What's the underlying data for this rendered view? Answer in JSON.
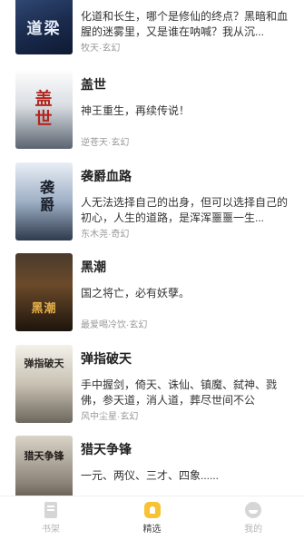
{
  "books": [
    {
      "cover_text": "道梁",
      "title": "",
      "desc": "化道和长生，哪个是修仙的终点？黑暗和血腥的迷雾里，又是谁在呐喊？我从沉...",
      "meta": "牧天·玄幻",
      "cover_style": "c0"
    },
    {
      "cover_text": "盖世",
      "title": "盖世",
      "desc": "神王重生，再续传说！",
      "meta": "逆苍天·玄幻",
      "cover_style": "c1"
    },
    {
      "cover_text": "袭爵",
      "title": "袭爵血路",
      "desc": "人无法选择自己的出身，但可以选择自己的初心，人生的道路，是浑浑噩噩一生...",
      "meta": "东木尧·奇幻",
      "cover_style": "c2"
    },
    {
      "cover_text": "黑潮",
      "title": "黑潮",
      "desc": "国之将亡，必有妖孽。",
      "meta": "最爱喝冷饮·玄幻",
      "cover_style": "c3"
    },
    {
      "cover_text": "弹指破天",
      "title": "弹指破天",
      "desc": "手中握剑，倚天、诛仙、镇魔、弑神、戮佛，参天道，消人道，葬尽世间不公",
      "meta": "风中尘星·玄幻",
      "cover_style": "c4"
    },
    {
      "cover_text": "猎天争锋",
      "title": "猎天争锋",
      "desc": "一元、两仪、三才、四象......",
      "meta": "",
      "cover_style": "c5"
    }
  ],
  "tabbar": {
    "tabs": [
      {
        "label": "书架",
        "icon": "bookshelf-icon",
        "active": false
      },
      {
        "label": "精选",
        "icon": "featured-icon",
        "active": true
      },
      {
        "label": "我的",
        "icon": "profile-icon",
        "active": false
      }
    ]
  },
  "colors": {
    "accent": "#f7c233",
    "text_primary": "#222222",
    "text_meta": "#999999",
    "tab_inactive": "#b6b6b6"
  }
}
